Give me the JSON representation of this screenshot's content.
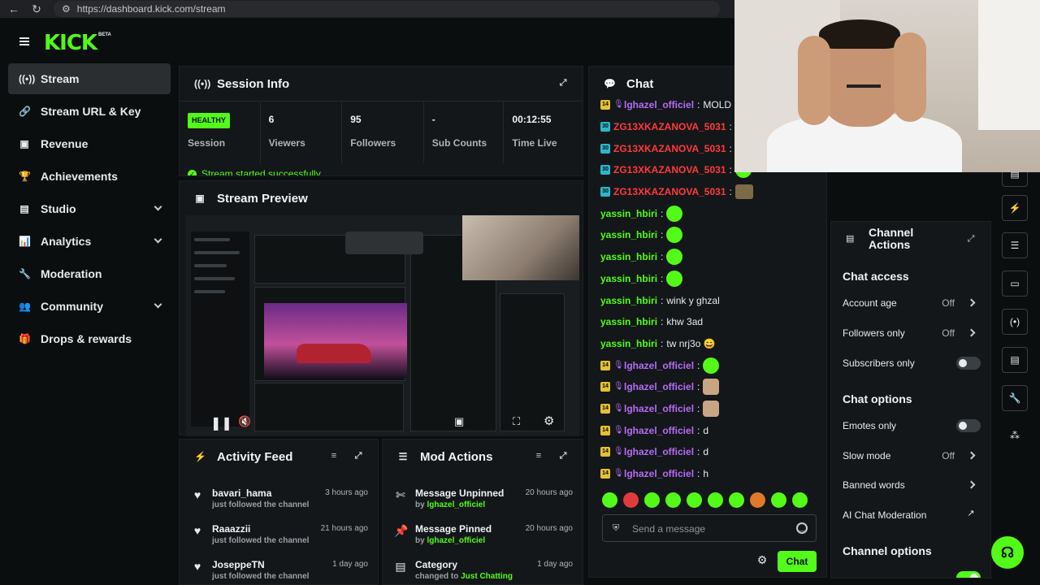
{
  "browser": {
    "url": "https://dashboard.kick.com/stream"
  },
  "brand": {
    "logo": "KICK",
    "beta": "BETA",
    "accent": "#53fc18"
  },
  "sidebar": {
    "items": [
      {
        "label": "Stream",
        "icon": "broadcast-icon",
        "active": true
      },
      {
        "label": "Stream URL & Key",
        "icon": "link-icon"
      },
      {
        "label": "Revenue",
        "icon": "wallet-icon"
      },
      {
        "label": "Achievements",
        "icon": "trophy-icon"
      },
      {
        "label": "Studio",
        "icon": "studio-icon",
        "expandable": true
      },
      {
        "label": "Analytics",
        "icon": "chart-icon",
        "expandable": true
      },
      {
        "label": "Moderation",
        "icon": "wrench-icon"
      },
      {
        "label": "Community",
        "icon": "users-icon",
        "expandable": true
      },
      {
        "label": "Drops & rewards",
        "icon": "gift-icon"
      }
    ]
  },
  "session": {
    "title": "Session Info",
    "status_badge": "HEALTHY",
    "metrics": [
      {
        "value": "",
        "label": "Session"
      },
      {
        "value": "6",
        "label": "Viewers"
      },
      {
        "value": "95",
        "label": "Followers"
      },
      {
        "value": "-",
        "label": "Sub Counts"
      },
      {
        "value": "00:12:55",
        "label": "Time Live"
      }
    ],
    "toast": "Stream started successfully"
  },
  "preview": {
    "title": "Stream Preview"
  },
  "activity": {
    "title": "Activity Feed",
    "items": [
      {
        "name": "bavari_hama",
        "sub": "just followed the channel",
        "time": "3 hours ago"
      },
      {
        "name": "Raaazzii",
        "sub": "just followed the channel",
        "time": "21 hours ago"
      },
      {
        "name": "JoseppeTN",
        "sub": "just followed the channel",
        "time": "1 day ago"
      }
    ]
  },
  "mod_actions": {
    "title": "Mod Actions",
    "items": [
      {
        "name": "Message Unpinned",
        "sub_prefix": "by",
        "by": "lghazel_officiel",
        "time": "20 hours ago"
      },
      {
        "name": "Message Pinned",
        "sub_prefix": "by",
        "by": "lghazel_officiel",
        "time": "20 hours ago"
      },
      {
        "name": "Category",
        "sub_prefix": "changed to",
        "by": "Just Chatting",
        "time": "1 day ago"
      }
    ]
  },
  "chat": {
    "title": "Chat",
    "messages": [
      {
        "badge": "14",
        "badge_type": "sub",
        "mic": true,
        "user": "lghazel_officiel",
        "color": "#b46cf5",
        "text": "MOLD"
      },
      {
        "badge": "30",
        "badge_type": "mod",
        "user": "ZG13XKAZANOVA_5031",
        "color": "#ff3b3b",
        "text": ""
      },
      {
        "badge": "30",
        "badge_type": "mod",
        "user": "ZG13XKAZANOVA_5031",
        "color": "#ff3b3b",
        "text": ""
      },
      {
        "badge": "30",
        "badge_type": "mod",
        "user": "ZG13XKAZANOVA_5031",
        "color": "#ff3b3b",
        "text": "",
        "emote": "green"
      },
      {
        "badge": "30",
        "badge_type": "mod",
        "user": "ZG13XKAZANOVA_5031",
        "color": "#ff3b3b",
        "text": "",
        "emote": "gg"
      },
      {
        "user": "yassin_hbiri",
        "color": "#53fc18",
        "text": "",
        "emote": "green"
      },
      {
        "user": "yassin_hbiri",
        "color": "#53fc18",
        "text": "",
        "emote": "green"
      },
      {
        "user": "yassin_hbiri",
        "color": "#53fc18",
        "text": "",
        "emote": "green"
      },
      {
        "user": "yassin_hbiri",
        "color": "#53fc18",
        "text": "",
        "emote": "green"
      },
      {
        "user": "yassin_hbiri",
        "color": "#53fc18",
        "text": "wink y ghzal"
      },
      {
        "user": "yassin_hbiri",
        "color": "#53fc18",
        "text": "khw 3ad"
      },
      {
        "user": "yassin_hbiri",
        "color": "#53fc18",
        "text": "tw nrj3o 😄"
      },
      {
        "badge": "14",
        "badge_type": "sub",
        "mic": true,
        "user": "lghazel_officiel",
        "color": "#b46cf5",
        "text": "",
        "emote": "green"
      },
      {
        "badge": "14",
        "badge_type": "sub",
        "mic": true,
        "user": "lghazel_officiel",
        "color": "#b46cf5",
        "text": "",
        "emote": "cat"
      },
      {
        "badge": "14",
        "badge_type": "sub",
        "mic": true,
        "user": "lghazel_officiel",
        "color": "#b46cf5",
        "text": "",
        "emote": "cat"
      },
      {
        "badge": "14",
        "badge_type": "sub",
        "mic": true,
        "user": "lghazel_officiel",
        "color": "#b46cf5",
        "text": "d"
      },
      {
        "badge": "14",
        "badge_type": "sub",
        "mic": true,
        "user": "lghazel_officiel",
        "color": "#b46cf5",
        "text": "d"
      },
      {
        "badge": "14",
        "badge_type": "sub",
        "mic": true,
        "user": "lghazel_officiel",
        "color": "#b46cf5",
        "text": "h"
      }
    ],
    "input_placeholder": "Send a message",
    "send_label": "Chat"
  },
  "channel_actions": {
    "title": "Channel Actions",
    "chat_access_heading": "Chat access",
    "account_age": {
      "label": "Account age",
      "value": "Off"
    },
    "followers_only": {
      "label": "Followers only",
      "value": "Off"
    },
    "subscribers_only": {
      "label": "Subscribers only"
    },
    "chat_options_heading": "Chat options",
    "emotes_only": {
      "label": "Emotes only"
    },
    "slow_mode": {
      "label": "Slow mode",
      "value": "Off"
    },
    "banned_words": {
      "label": "Banned words"
    },
    "ai_moderation": {
      "label": "AI Chat Moderation"
    },
    "channel_options_heading": "Channel options"
  }
}
